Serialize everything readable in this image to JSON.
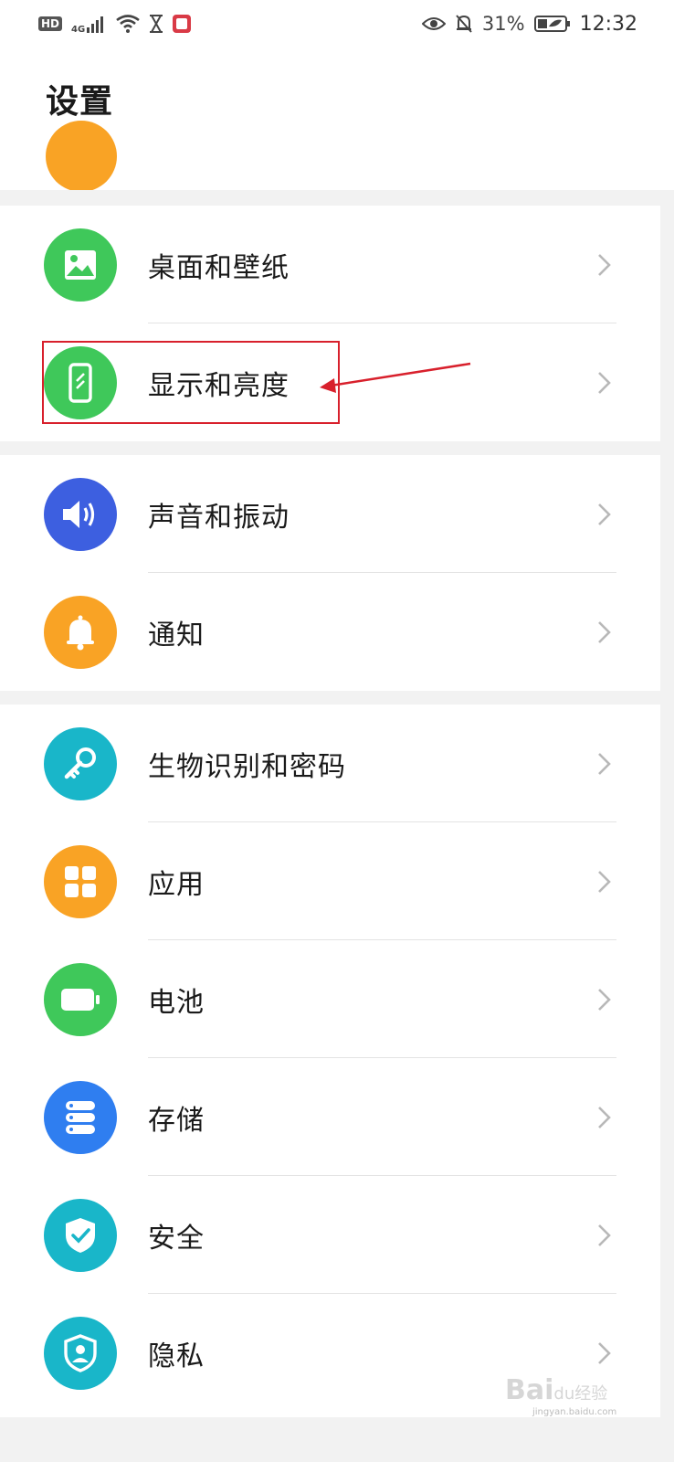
{
  "status_bar": {
    "hd": "HD",
    "network": "4G",
    "battery_pct": "31%",
    "time": "12:32"
  },
  "header": {
    "title": "设置"
  },
  "groups": [
    {
      "items": [
        {
          "label": "桌面和壁纸",
          "icon": "wallpaper-icon",
          "color": "#3fc85a"
        },
        {
          "label": "显示和亮度",
          "icon": "display-icon",
          "color": "#3fc85a",
          "highlighted": true
        }
      ]
    },
    {
      "items": [
        {
          "label": "声音和振动",
          "icon": "sound-icon",
          "color": "#3d5fe0"
        },
        {
          "label": "通知",
          "icon": "notification-bell-icon",
          "color": "#f9a325"
        }
      ]
    },
    {
      "items": [
        {
          "label": "生物识别和密码",
          "icon": "key-icon",
          "color": "#19b6c9"
        },
        {
          "label": "应用",
          "icon": "apps-grid-icon",
          "color": "#f9a325"
        },
        {
          "label": "电池",
          "icon": "battery-icon",
          "color": "#3fc85a"
        },
        {
          "label": "存储",
          "icon": "storage-icon",
          "color": "#2f7ef0"
        },
        {
          "label": "安全",
          "icon": "security-shield-icon",
          "color": "#19b6c9"
        },
        {
          "label": "隐私",
          "icon": "privacy-icon",
          "color": "#19b6c9"
        }
      ]
    }
  ],
  "watermark": {
    "brand": "Bai",
    "brand_suffix": "du",
    "cn": "经验",
    "url": "jingyan.baidu.com"
  },
  "colors": {
    "annotation": "#d8202c",
    "chevron": "#b8b8b8"
  }
}
